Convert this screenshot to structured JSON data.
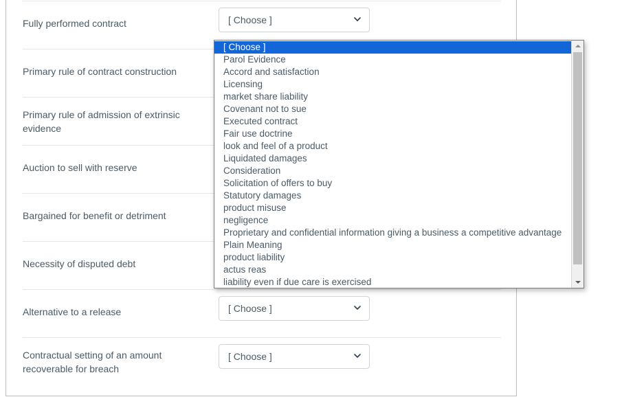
{
  "question": {
    "rows": [
      {
        "label": "Fully performed contract",
        "select_value": "[ Choose ]",
        "open": true
      },
      {
        "label": "Primary rule of contract construction",
        "select_value": "[ Choose ]",
        "open": false
      },
      {
        "label": "Primary rule of admission of extrinsic evidence",
        "select_value": "[ Choose ]",
        "open": false
      },
      {
        "label": "Auction to sell with reserve",
        "select_value": "[ Choose ]",
        "open": false
      },
      {
        "label": "Bargained for benefit or detriment",
        "select_value": "[ Choose ]",
        "open": false
      },
      {
        "label": "Necessity of disputed debt",
        "select_value": "[ Choose ]",
        "open": false
      },
      {
        "label": "Alternative to a release",
        "select_value": "[ Choose ]",
        "open": false
      },
      {
        "label": "Contractual setting of an amount recoverable for breach",
        "select_value": "[ Choose ]",
        "open": false
      }
    ]
  },
  "dropdown": {
    "selected_value": "[ Choose ]",
    "options": [
      "[ Choose ]",
      "Parol Evidence",
      "Accord and satisfaction",
      "Licensing",
      "market share liability",
      "Covenant not to sue",
      "Executed contract",
      "Fair use doctrine",
      "look and feel of a product",
      "Liquidated damages",
      "Consideration",
      "Solicitation of offers to buy",
      "Statutory damages",
      "product misuse",
      "negligence",
      "Proprietary and confidential information giving a business a competitive advantage",
      "Plain Meaning",
      "product liability",
      "actus reas",
      "liability even if due care is exercised"
    ],
    "selected_index": 0,
    "scrollbar": {
      "up_arrow": "▲",
      "down_arrow": "▼"
    }
  },
  "colors": {
    "highlight": "#1266d8",
    "text": "#4a5a67",
    "row_divider": "#e6e6e6",
    "card_border": "#bcbcbc",
    "select_border": "#ced4da",
    "popup_border": "#7a7a7a",
    "scrollbar_track": "#f0f0f0",
    "scrollbar_thumb": "#c0c0c0"
  }
}
